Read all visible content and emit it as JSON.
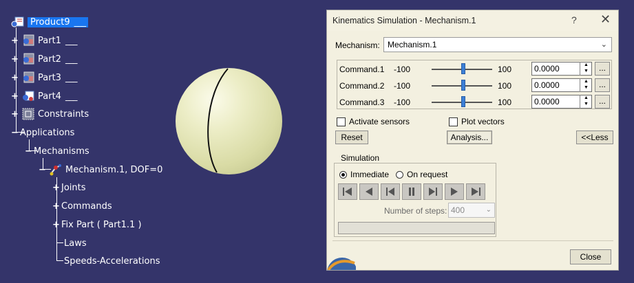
{
  "tree": {
    "root": {
      "label": "Product9",
      "tail": "___"
    },
    "parts": [
      {
        "label": "Part1",
        "tail": "___"
      },
      {
        "label": "Part2",
        "tail": "___"
      },
      {
        "label": "Part3",
        "tail": "___"
      },
      {
        "label": "Part4",
        "tail": "___"
      }
    ],
    "constraints": "Constraints",
    "applications": "Applications",
    "mechanisms": "Mechanisms",
    "mechanism": "Mechanism.1, DOF=0",
    "children": [
      "Joints",
      "Commands",
      "Fix Part ( Part1.1 )",
      "Laws",
      "Speeds-Accelerations"
    ]
  },
  "dialog": {
    "title": "Kinematics Simulation - Mechanism.1",
    "help": "?",
    "close_x": "✕",
    "mechanism_label": "Mechanism:",
    "mechanism_value": "Mechanism.1",
    "commands": [
      {
        "label": "Command.1",
        "min": "-100",
        "max": "100",
        "value": "0.0000",
        "slider_level": 0.5
      },
      {
        "label": "Command.2",
        "min": "-100",
        "max": "100",
        "value": "0.0000",
        "slider_level": 0.5
      },
      {
        "label": "Command.3",
        "min": "-100",
        "max": "100",
        "value": "0.0000",
        "slider_level": 0.5
      }
    ],
    "dots_label": "...",
    "activate_sensors": "Activate sensors",
    "plot_vectors": "Plot vectors",
    "reset": "Reset",
    "analysis": "Analysis...",
    "less": "<<Less",
    "simulation_legend": "Simulation",
    "immediate": "Immediate",
    "on_request": "On request",
    "steps_label": "Number of steps:",
    "steps_value": "400",
    "close": "Close"
  },
  "colors": {
    "background": "#34346a",
    "selection": "#1976f0",
    "dialog_bg": "#f3f0e0",
    "sphere": "#e3e5b5"
  }
}
